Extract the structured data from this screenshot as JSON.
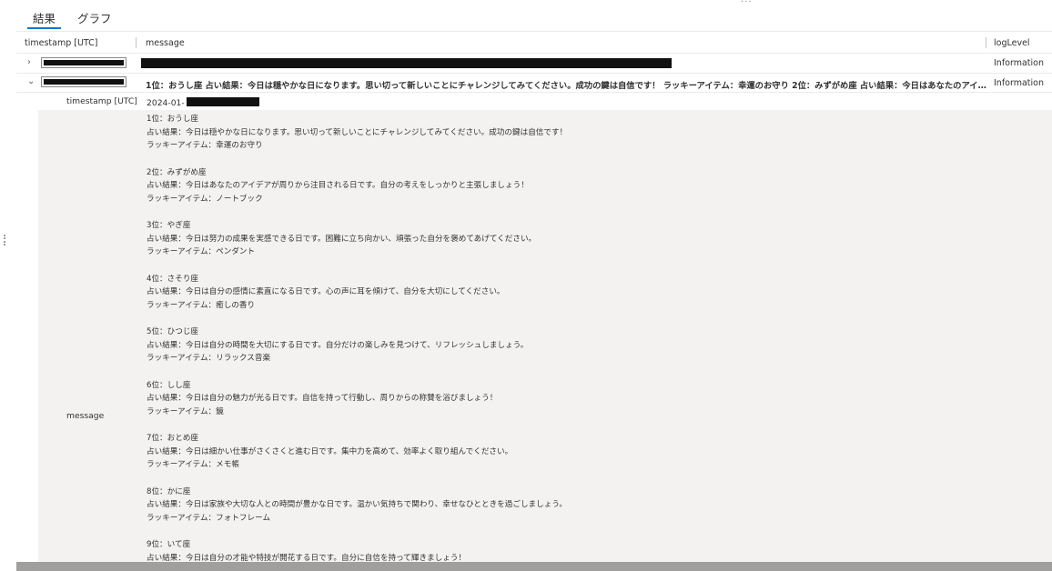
{
  "tabs": [
    {
      "label": "結果",
      "active": true
    },
    {
      "label": "グラフ",
      "active": false
    }
  ],
  "columns": {
    "timestamp": "timestamp [UTC]",
    "message": "message",
    "loglevel": "logLevel"
  },
  "rows": [
    {
      "level": "Information",
      "message": ""
    },
    {
      "level": "Information",
      "message": "1位：おうし座 占い結果：今日は穏やかな日になります。思い切って新しいことにチャレンジしてみてください。成功の鍵は自信です！ ラッキーアイテム：幸運のお守り 2位：みずがめ座 占い結果：今日はあなたのアイデア..."
    }
  ],
  "detail": {
    "timestamp_label": "timestamp [UTC]",
    "timestamp_value": "2024-01-",
    "message_label": "message",
    "entries": [
      {
        "rank": "1位：おうし座",
        "result": "占い結果：今日は穏やかな日になります。思い切って新しいことにチャレンジしてみてください。成功の鍵は自信です！",
        "item": "ラッキーアイテム：幸運のお守り"
      },
      {
        "rank": "2位：みずがめ座",
        "result": "占い結果：今日はあなたのアイデアが周りから注目される日です。自分の考えをしっかりと主張しましょう！",
        "item": "ラッキーアイテム：ノートブック"
      },
      {
        "rank": "3位：やぎ座",
        "result": "占い結果：今日は努力の成果を実感できる日です。困難に立ち向かい、頑張った自分を褒めてあげてください。",
        "item": "ラッキーアイテム：ペンダント"
      },
      {
        "rank": "4位：さそり座",
        "result": "占い結果：今日は自分の感情に素直になる日です。心の声に耳を傾けて、自分を大切にしてください。",
        "item": "ラッキーアイテム：癒しの香り"
      },
      {
        "rank": "5位：ひつじ座",
        "result": "占い結果：今日は自分の時間を大切にする日です。自分だけの楽しみを見つけて、リフレッシュしましょう。",
        "item": "ラッキーアイテム：リラックス音楽"
      },
      {
        "rank": "6位：しし座",
        "result": "占い結果：今日は自分の魅力が光る日です。自信を持って行動し、周りからの称賛を浴びましょう！",
        "item": "ラッキーアイテム：鏡"
      },
      {
        "rank": "7位：おとめ座",
        "result": "占い結果：今日は細かい仕事がさくさくと進む日です。集中力を高めて、効率よく取り組んでください。",
        "item": "ラッキーアイテム：メモ帳"
      },
      {
        "rank": "8位：かに座",
        "result": "占い結果：今日は家族や大切な人との時間が豊かな日です。温かい気持ちで関わり、幸せなひとときを過ごしましょう。",
        "item": "ラッキーアイテム：フォトフレーム"
      },
      {
        "rank": "9位：いて座",
        "result": "占い結果：今日は自分の才能や特技が開花する日です。自分に自信を持って輝きましょう！",
        "item": ""
      }
    ]
  },
  "icons": {
    "collapsed": "chevron-right-icon",
    "expanded": "chevron-down-icon"
  },
  "colors": {
    "accent": "#0078d4",
    "detail_bg": "#f3f2f1",
    "redaction": "#111111"
  }
}
